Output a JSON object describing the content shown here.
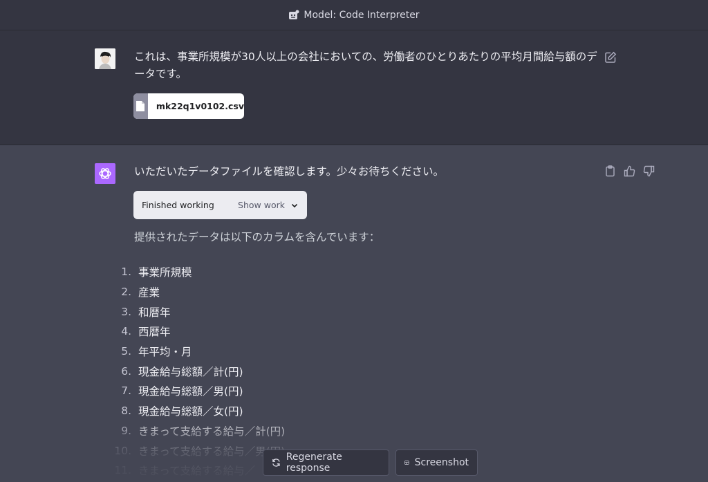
{
  "header": {
    "model_label": "Model: Code Interpreter"
  },
  "user_message": {
    "text": "これは、事業所規模が30人以上の会社においての、労働者のひとりあたりの平均月間給与額のデータです。",
    "attachment": {
      "file_name": "mk22q1v0102.csv"
    }
  },
  "assistant_message": {
    "intro": "いただいたデータファイルを確認します。少々お待ちください。",
    "work_box": {
      "status": "Finished working",
      "toggle_label": "Show work"
    },
    "columns_intro": "提供されたデータは以下のカラムを含んでいます：",
    "columns": [
      {
        "num": "1.",
        "label": "事業所規模"
      },
      {
        "num": "2.",
        "label": "産業"
      },
      {
        "num": "3.",
        "label": "和暦年"
      },
      {
        "num": "4.",
        "label": "西暦年"
      },
      {
        "num": "5.",
        "label": "年平均・月"
      },
      {
        "num": "6.",
        "label": "現金給与総額／計(円)"
      },
      {
        "num": "7.",
        "label": "現金給与総額／男(円)"
      },
      {
        "num": "8.",
        "label": "現金給与総額／女(円)"
      },
      {
        "num": "9.",
        "label": "きまって支給する給与／計(円)"
      },
      {
        "num": "10.",
        "label": "きまって支給する給与／男(円)"
      },
      {
        "num": "11.",
        "label": "きまって支給する給与／"
      }
    ]
  },
  "bottom_actions": {
    "regenerate_label": "Regenerate response",
    "screenshot_label": "Screenshot"
  },
  "colors": {
    "page_bg": "#444654",
    "user_bg": "#343541",
    "assistant_avatar": "#ab68ff"
  }
}
